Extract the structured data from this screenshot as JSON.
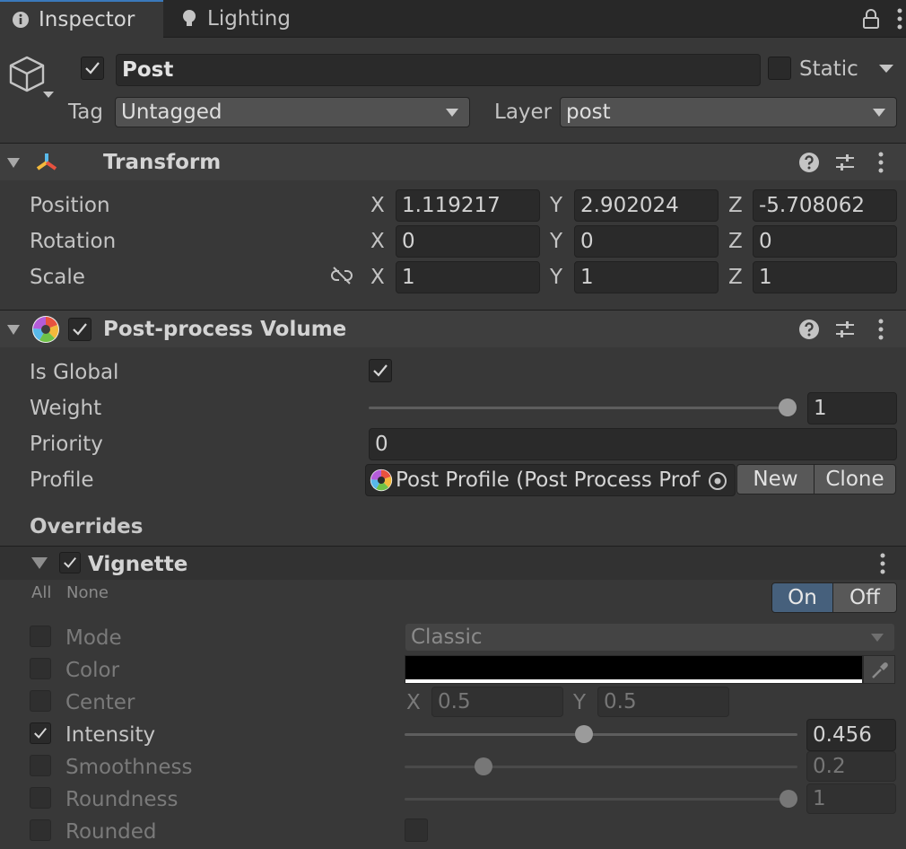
{
  "tabs": [
    {
      "label": "Inspector",
      "icon": "info-icon",
      "active": true
    },
    {
      "label": "Lighting",
      "icon": "lightbulb-icon",
      "active": false
    }
  ],
  "gameobject": {
    "name": "Post",
    "active": true,
    "static_label": "Static",
    "static": false,
    "tag_label": "Tag",
    "tag_value": "Untagged",
    "layer_label": "Layer",
    "layer_value": "post"
  },
  "transform": {
    "title": "Transform",
    "position_label": "Position",
    "rotation_label": "Rotation",
    "scale_label": "Scale",
    "axis_x": "X",
    "axis_y": "Y",
    "axis_z": "Z",
    "position": {
      "x": "1.119217",
      "y": "2.902024",
      "z": "-5.708062"
    },
    "rotation": {
      "x": "0",
      "y": "0",
      "z": "0"
    },
    "scale": {
      "x": "1",
      "y": "1",
      "z": "1"
    }
  },
  "volume": {
    "title": "Post-process Volume",
    "enabled": true,
    "is_global_label": "Is Global",
    "is_global": true,
    "weight_label": "Weight",
    "weight": "1",
    "weight_fraction": 1.0,
    "priority_label": "Priority",
    "priority": "0",
    "profile_label": "Profile",
    "profile_value": "Post Profile (Post Process Profi",
    "new_label": "New",
    "clone_label": "Clone",
    "overrides_label": "Overrides"
  },
  "vignette": {
    "title": "Vignette",
    "enabled": true,
    "all_label": "All",
    "none_label": "None",
    "on_label": "On",
    "off_label": "Off",
    "state": "On",
    "mode_label": "Mode",
    "mode_value": "Classic",
    "color_label": "Color",
    "color_value": "#000000",
    "center_label": "Center",
    "center_axis_x": "X",
    "center_axis_y": "Y",
    "center_x": "0.5",
    "center_y": "0.5",
    "intensity_label": "Intensity",
    "intensity": "0.456",
    "intensity_fraction": 0.456,
    "smoothness_label": "Smoothness",
    "smoothness": "0.2",
    "smoothness_fraction": 0.2,
    "roundness_label": "Roundness",
    "roundness": "1",
    "roundness_fraction": 1.0,
    "rounded_label": "Rounded"
  },
  "colors": {
    "accent": "#3a79bb",
    "background": "#383838"
  }
}
